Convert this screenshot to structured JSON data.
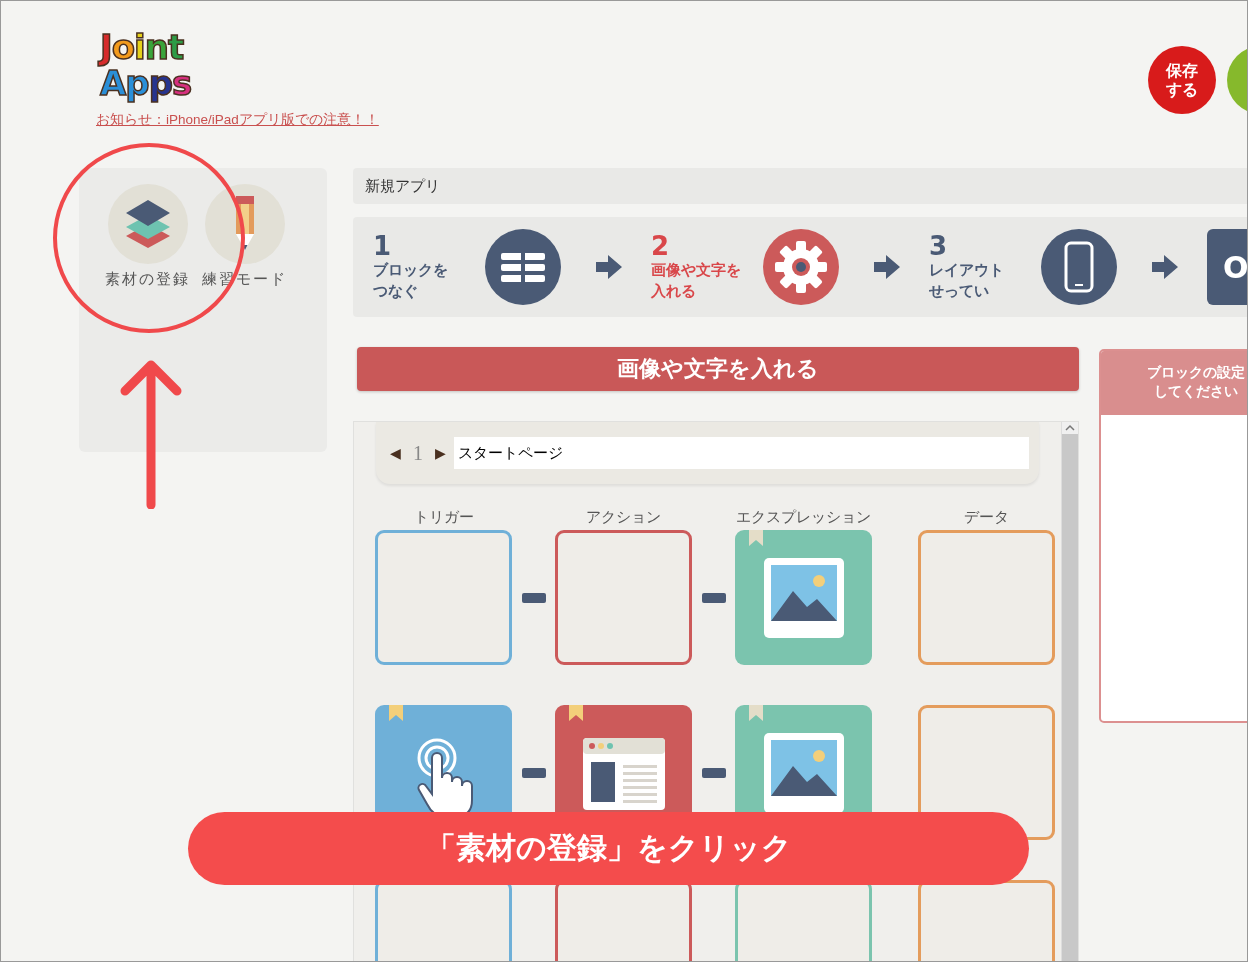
{
  "logo": {
    "line1": "Joint",
    "line2": "Apps"
  },
  "notice_link": "お知らせ：iPhone/iPadアプリ版での注意！！",
  "header_buttons": [
    {
      "label": [
        "保存",
        "する"
      ],
      "color": "#d81b1b"
    },
    {
      "color": "#86b92c"
    }
  ],
  "tools": [
    {
      "kind": "layers",
      "label": "素材の登録"
    },
    {
      "kind": "pencil",
      "label": "練習モード"
    }
  ],
  "breadcrumb": "新規アプリ",
  "steps": [
    {
      "kind": "blocks",
      "number": "1",
      "label": [
        "ブロックを",
        "つなぐ"
      ],
      "selected": false
    },
    {
      "kind": "gear",
      "number": "2",
      "label": [
        "画像や文字を",
        "入れる"
      ],
      "selected": true
    },
    {
      "kind": "phone",
      "number": "3",
      "label": [
        "レイアウト",
        "せってい"
      ],
      "selected": false
    },
    {
      "kind": "final",
      "label": "O",
      "selected": false
    }
  ],
  "section_title": "画像や文字を入れる",
  "settings_panel": {
    "title": [
      "ブロックの設定",
      "してください"
    ]
  },
  "page_nav": {
    "prev": "◀",
    "page": "1",
    "next": "▶",
    "page_name": "スタートページ"
  },
  "columns": [
    {
      "label": "トリガー",
      "color": "#6fb0d8"
    },
    {
      "label": "アクション",
      "color": "#cc5a5a"
    },
    {
      "label": "エクスプレッション",
      "color": "#7bc4ae"
    },
    {
      "label": "データ",
      "color": "#e49c5c"
    }
  ],
  "rows": [
    {
      "connectors": [
        {
          "kind": "dash"
        },
        {
          "kind": "dash"
        }
      ],
      "tiles": [
        {
          "kind": "empty"
        },
        {
          "kind": "empty"
        },
        {
          "kind": "image"
        },
        {
          "kind": "empty"
        }
      ]
    },
    {
      "connectors": [
        {
          "kind": "dash"
        },
        {
          "kind": "dash"
        }
      ],
      "tiles": [
        {
          "kind": "touch"
        },
        {
          "kind": "webpage"
        },
        {
          "kind": "image"
        },
        {
          "kind": "empty"
        }
      ]
    },
    {
      "tiles": [
        {
          "kind": "empty"
        },
        {
          "kind": "empty"
        },
        {
          "kind": "empty"
        },
        {
          "kind": "empty"
        }
      ]
    }
  ],
  "callout": "「素材の登録」をクリック"
}
